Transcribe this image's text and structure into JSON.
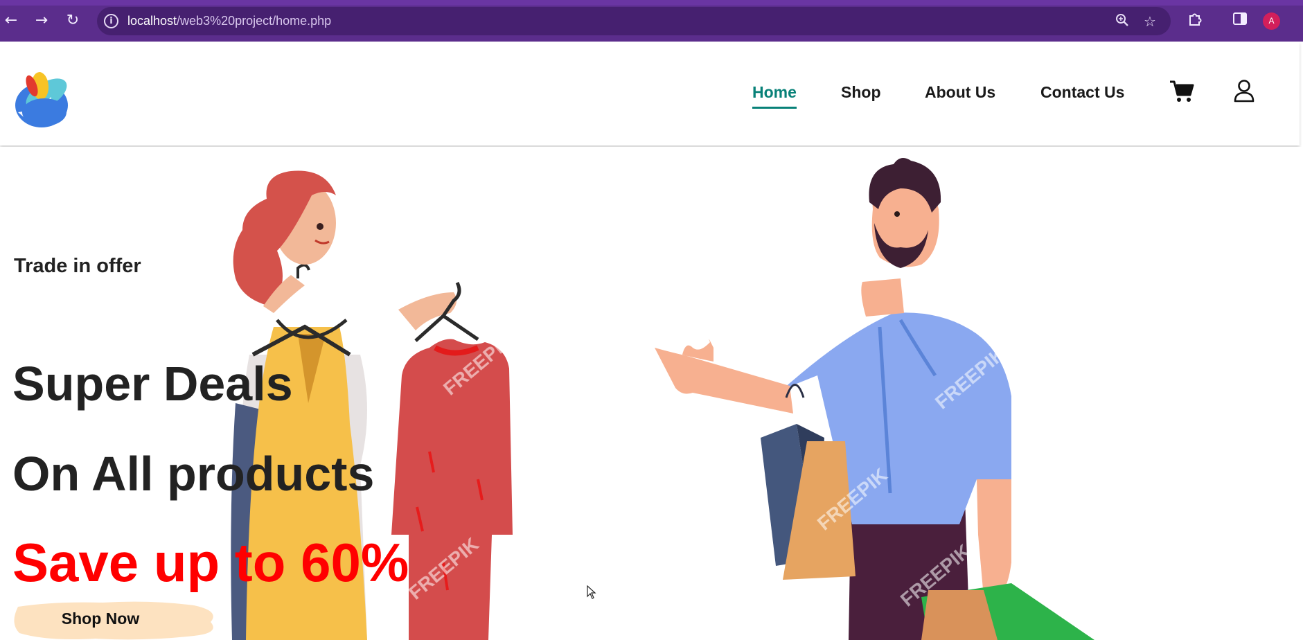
{
  "browser": {
    "url_host": "localhost",
    "url_path": "/web3%20project/home.php",
    "profile_initial": "A",
    "colors": {
      "frame": "#5b2d8c",
      "omnibox": "#462070",
      "profile": "#d31f5b"
    }
  },
  "header": {
    "nav": [
      {
        "label": "Home",
        "active": true
      },
      {
        "label": "Shop",
        "active": false
      },
      {
        "label": "About Us",
        "active": false
      },
      {
        "label": "Contact Us",
        "active": false
      }
    ],
    "icons": [
      "logo",
      "cart-icon",
      "user-icon"
    ],
    "accent_color": "#088178"
  },
  "hero": {
    "eyebrow": "Trade in offer",
    "line1": "Super Deals",
    "line2": "On All products",
    "highlight": "Save up to 60%",
    "highlight_color": "#ff0000",
    "cta_label": "Shop Now",
    "watermark": "FREEPIK"
  }
}
